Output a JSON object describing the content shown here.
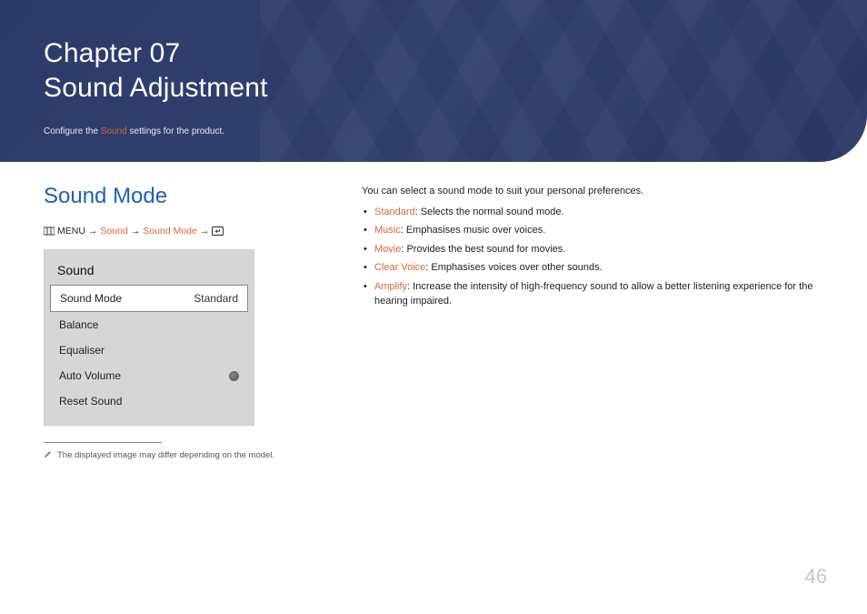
{
  "banner": {
    "chapter_line": "Chapter  07",
    "title_line": "Sound Adjustment",
    "desc_pre": "Configure the ",
    "desc_highlight": "Sound",
    "desc_post": " settings for the product."
  },
  "section": {
    "title": "Sound Mode"
  },
  "breadcrumb": {
    "menu_label": "MENU",
    "arrow": "→",
    "p1": "Sound",
    "p2": "Sound Mode"
  },
  "menu": {
    "title": "Sound",
    "items": [
      {
        "label": "Sound Mode",
        "value": "Standard",
        "selected": true
      },
      {
        "label": "Balance"
      },
      {
        "label": "Equaliser"
      },
      {
        "label": "Auto Volume",
        "radio": true
      },
      {
        "label": "Reset Sound"
      }
    ]
  },
  "footnote": "The displayed image may differ depending on the model.",
  "description": "You can select a sound mode to suit your personal preferences.",
  "modes": [
    {
      "name": "Standard",
      "desc": ": Selects the normal sound mode."
    },
    {
      "name": "Music",
      "desc": ": Emphasises music over voices."
    },
    {
      "name": "Movie",
      "desc": ": Provides the best sound for movies."
    },
    {
      "name": "Clear Voice",
      "desc": ": Emphasises voices over other sounds."
    },
    {
      "name": "Amplify",
      "desc": ": Increase the intensity of high-frequency sound to allow a better listening experience for the hearing impaired."
    }
  ],
  "page_number": "46"
}
